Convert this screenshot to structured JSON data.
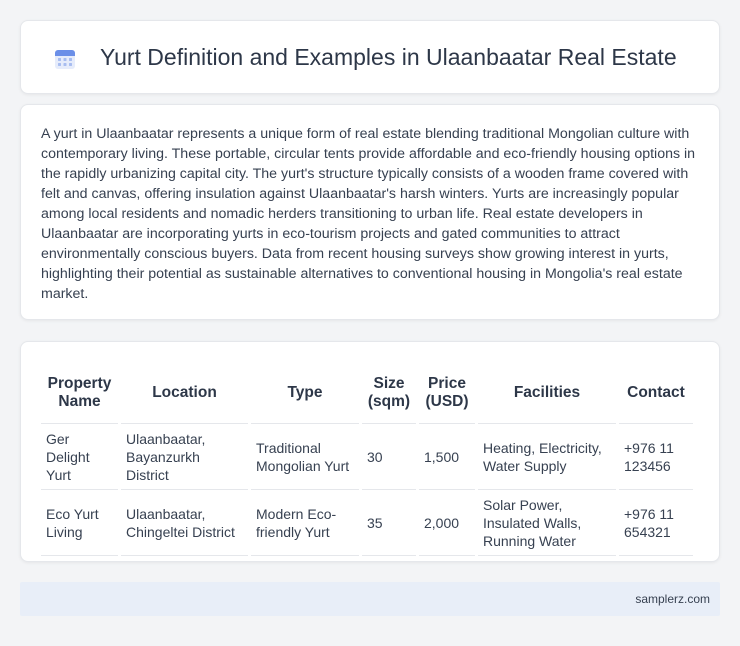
{
  "header": {
    "title": "Yurt Definition and Examples in Ulaanbaatar Real Estate",
    "icon": "calendar-icon"
  },
  "intro": {
    "text": "A yurt in Ulaanbaatar represents a unique form of real estate blending traditional Mongolian culture with contemporary living. These portable, circular tents provide affordable and eco-friendly housing options in the rapidly urbanizing capital city. The yurt's structure typically consists of a wooden frame covered with felt and canvas, offering insulation against Ulaanbaatar's harsh winters. Yurts are increasingly popular among local residents and nomadic herders transitioning to urban life. Real estate developers in Ulaanbaatar are incorporating yurts in eco-tourism projects and gated communities to attract environmentally conscious buyers. Data from recent housing surveys show growing interest in yurts, highlighting their potential as sustainable alternatives to conventional housing in Mongolia's real estate market."
  },
  "table": {
    "headers": [
      "Property Name",
      "Location",
      "Type",
      "Size (sqm)",
      "Price (USD)",
      "Facilities",
      "Contact"
    ],
    "rows": [
      [
        "Ger Delight Yurt",
        "Ulaanbaatar, Bayanzurkh District",
        "Traditional Mongolian Yurt",
        "30",
        "1,500",
        "Heating, Electricity, Water Supply",
        "+976 11 123456"
      ],
      [
        "Eco Yurt Living",
        "Ulaanbaatar, Chingeltei District",
        "Modern Eco-friendly Yurt",
        "35",
        "2,000",
        "Solar Power, Insulated Walls, Running Water",
        "+976 11 654321"
      ]
    ]
  },
  "footer": {
    "text": "samplerz.com"
  },
  "colors": {
    "background": "#f3f4f6",
    "card": "#ffffff",
    "footer": "#e8eef8",
    "icon_accent": "#6b8fe8"
  }
}
